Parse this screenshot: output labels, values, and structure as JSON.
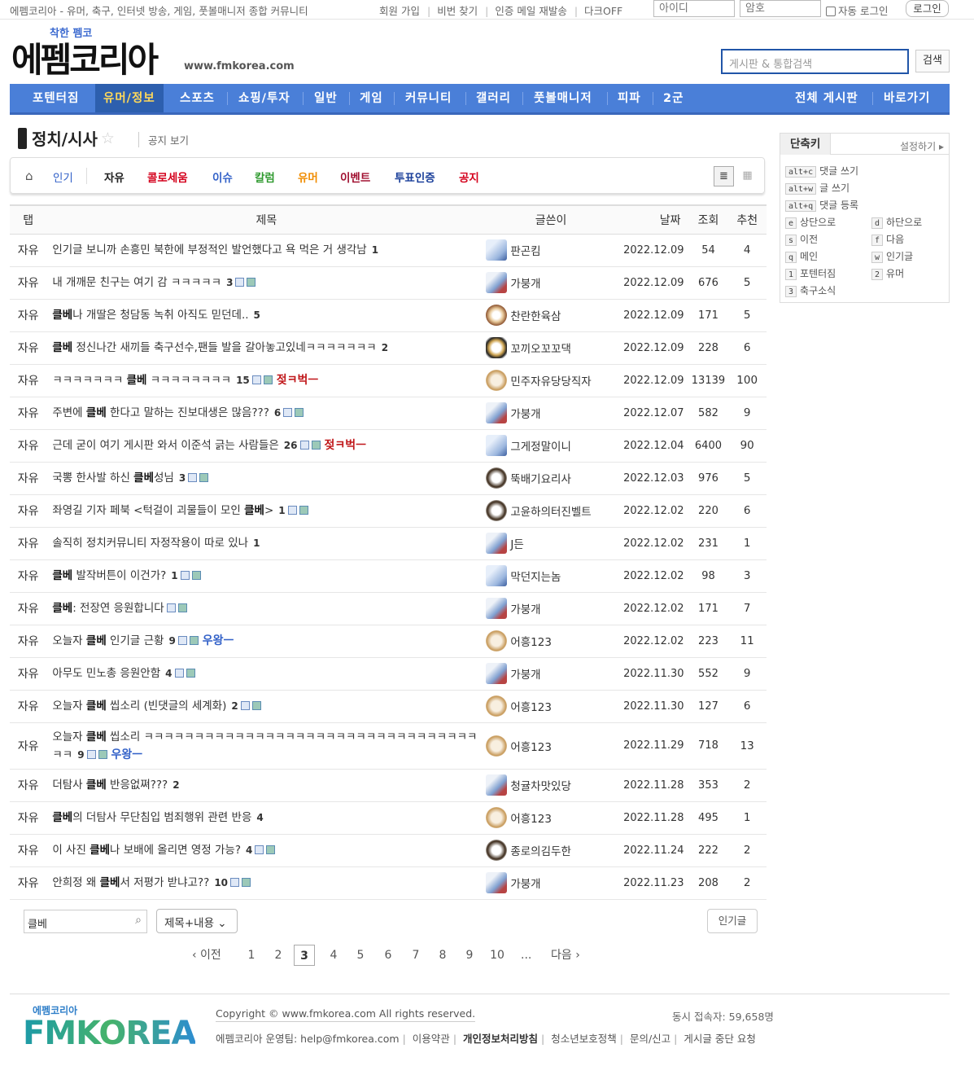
{
  "topbar": {
    "site_desc": "에펨코리아 - 유머, 축구, 인터넷 방송, 게임, 풋볼매니저 종합 커뮤니티",
    "links": [
      "회원 가입",
      "비번 찾기",
      "인증 메일 재발송",
      "다크OFF"
    ],
    "id_placeholder": "아이디",
    "pw_placeholder": "암호",
    "auto_login": "자동 로그인",
    "login": "로그인"
  },
  "header": {
    "slogan": "착한 펨코",
    "logo": "에펨코리아",
    "url": "www.fmkorea.com",
    "search_placeholder": "게시판 & 통합검색",
    "search_button": "검색"
  },
  "gnb": {
    "items": [
      "포텐터짐",
      "유머/정보",
      "스포츠",
      "쇼핑/투자",
      "일반",
      "게임",
      "커뮤니티",
      "갤러리",
      "풋볼매니저",
      "피파",
      "2군"
    ],
    "active": "유머/정보",
    "right": [
      "전체 게시판",
      "바로가기"
    ]
  },
  "board": {
    "title": "정치/시사",
    "notice_link": "공지 보기",
    "tabs": [
      {
        "label": "인기",
        "color": "#3261c8"
      },
      {
        "label": "자유",
        "color": "#222222"
      },
      {
        "label": "콜로세움",
        "color": "#d4001c"
      },
      {
        "label": "이슈",
        "color": "#3261c8"
      },
      {
        "label": "칼럼",
        "color": "#2f9a2f"
      },
      {
        "label": "유머",
        "color": "#f08c00"
      },
      {
        "label": "이벤트",
        "color": "#a01030"
      },
      {
        "label": "투표인증",
        "color": "#1a3f9a"
      },
      {
        "label": "공지",
        "color": "#d4001c"
      }
    ]
  },
  "table": {
    "headers": [
      "탭",
      "제목",
      "글쓴이",
      "날짜",
      "조회",
      "추천"
    ],
    "rows": [
      {
        "cat": "자유",
        "pre": "인기글 보니까 손흥민 북한에 부정적인 발언했다고 욕 먹은 거 생각남",
        "kw": "",
        "post": "",
        "comments": "1",
        "icons": 0,
        "badge": "",
        "author": "판곤킴",
        "av": "a1",
        "date": "2022.12.09",
        "views": "54",
        "rec": "4"
      },
      {
        "cat": "자유",
        "pre": "내 개깨문 친구는 여기 감 ㅋㅋㅋㅋㅋ",
        "kw": "",
        "post": "",
        "comments": "3",
        "icons": 2,
        "badge": "",
        "author": "가붕개",
        "av": "a2",
        "date": "2022.12.09",
        "views": "676",
        "rec": "5"
      },
      {
        "cat": "자유",
        "pre": "",
        "kw": "클베",
        "post": "나 개딸은 청담동 녹취 아직도 믿던데..",
        "comments": "5",
        "icons": 0,
        "badge": "",
        "author": "찬란한육삼",
        "av": "a3",
        "date": "2022.12.09",
        "views": "171",
        "rec": "5"
      },
      {
        "cat": "자유",
        "pre": "",
        "kw": "클베",
        "post": " 정신나간 새끼들 축구선수,팬들 발을 갈아놓고있네ㅋㅋㅋㅋㅋㅋㅋ",
        "comments": "2",
        "icons": 0,
        "badge": "",
        "author": "꼬끼오꼬꼬댁",
        "av": "a6",
        "date": "2022.12.09",
        "views": "228",
        "rec": "6"
      },
      {
        "cat": "자유",
        "pre": "ㅋㅋㅋㅋㅋㅋㅋ ",
        "kw": "클베",
        "post": " ㅋㅋㅋㅋㅋㅋㅋㅋ",
        "comments": "15",
        "icons": 2,
        "badge": "젖ㅋ벅ㅡ",
        "badge_color": "#c0181b",
        "author": "민주자유당당직자",
        "av": "a4",
        "date": "2022.12.09",
        "views": "13139",
        "rec": "100"
      },
      {
        "cat": "자유",
        "pre": "주변에 ",
        "kw": "클베",
        "post": " 한다고 말하는 진보대생은 많음???",
        "comments": "6",
        "icons": 2,
        "badge": "",
        "author": "가붕개",
        "av": "a2",
        "date": "2022.12.07",
        "views": "582",
        "rec": "9"
      },
      {
        "cat": "자유",
        "pre": "근데 굳이 여기 게시판 와서 이준석 긁는 사람들은",
        "kw": "",
        "post": "",
        "comments": "26",
        "icons": 2,
        "badge": "젖ㅋ벅ㅡ",
        "badge_color": "#c0181b",
        "author": "그게정말이니",
        "av": "a1",
        "date": "2022.12.04",
        "views": "6400",
        "rec": "90"
      },
      {
        "cat": "자유",
        "pre": "국뽕 한사발 하신 ",
        "kw": "클베",
        "post": "성님",
        "comments": "3",
        "icons": 2,
        "badge": "",
        "author": "뚝배기요리사",
        "av": "a5",
        "date": "2022.12.03",
        "views": "976",
        "rec": "5"
      },
      {
        "cat": "자유",
        "pre": "좌영길 기자 페북 <턱걸이 괴물들이 모인 ",
        "kw": "클베",
        "post": ">",
        "comments": "1",
        "icons": 2,
        "badge": "",
        "author": "고윤하의터진벨트",
        "av": "a5",
        "date": "2022.12.02",
        "views": "220",
        "rec": "6"
      },
      {
        "cat": "자유",
        "pre": "솔직히 정치커뮤니티 자정작용이 따로 있나",
        "kw": "",
        "post": "",
        "comments": "1",
        "icons": 0,
        "badge": "",
        "author": "J든",
        "av": "a2",
        "date": "2022.12.02",
        "views": "231",
        "rec": "1"
      },
      {
        "cat": "자유",
        "pre": "",
        "kw": "클베",
        "post": " 발작버튼이 이건가?",
        "comments": "1",
        "icons": 2,
        "badge": "",
        "author": "막던지는놈",
        "av": "a1",
        "date": "2022.12.02",
        "views": "98",
        "rec": "3"
      },
      {
        "cat": "자유",
        "pre": "",
        "kw": "클베",
        "post": ": 전장연 응원합니다",
        "comments": "",
        "icons": 2,
        "badge": "",
        "author": "가붕개",
        "av": "a2",
        "date": "2022.12.02",
        "views": "171",
        "rec": "7"
      },
      {
        "cat": "자유",
        "pre": "오늘자 ",
        "kw": "클베",
        "post": " 인기글 근황",
        "comments": "9",
        "icons": 2,
        "badge": "우왕ㅡ",
        "badge_color": "#3261c8",
        "author": "어흥123",
        "av": "a4",
        "date": "2022.12.02",
        "views": "223",
        "rec": "11"
      },
      {
        "cat": "자유",
        "pre": "아무도 민노총 응원안함",
        "kw": "",
        "post": "",
        "comments": "4",
        "icons": 2,
        "badge": "",
        "author": "가붕개",
        "av": "a2",
        "date": "2022.11.30",
        "views": "552",
        "rec": "9"
      },
      {
        "cat": "자유",
        "pre": "오늘자 ",
        "kw": "클베",
        "post": " 씹소리 (빈댓글의 세계화)",
        "comments": "2",
        "icons": 2,
        "badge": "",
        "author": "어흥123",
        "av": "a4",
        "date": "2022.11.30",
        "views": "127",
        "rec": "6"
      },
      {
        "cat": "자유",
        "pre": "오늘자 ",
        "kw": "클베",
        "post": " 씹소리 ㅋㅋㅋㅋㅋㅋㅋㅋㅋㅋㅋㅋㅋㅋㅋㅋㅋㅋㅋㅋㅋㅋㅋㅋㅋㅋㅋㅋㅋㅋㅋㅋㅋㅋㅋ",
        "comments": "9",
        "icons": 2,
        "badge": "우왕ㅡ",
        "badge_color": "#3261c8",
        "author": "어흥123",
        "av": "a4",
        "date": "2022.11.29",
        "views": "718",
        "rec": "13",
        "tall": true
      },
      {
        "cat": "자유",
        "pre": "더탐사 ",
        "kw": "클베",
        "post": " 반응없쪄???",
        "comments": "2",
        "icons": 0,
        "badge": "",
        "author": "청귤차맛있당",
        "av": "a2",
        "date": "2022.11.28",
        "views": "353",
        "rec": "2"
      },
      {
        "cat": "자유",
        "pre": "",
        "kw": "클베",
        "post": "의 더탐사 무단침입 범죄행위 관련 반응",
        "comments": "4",
        "icons": 0,
        "badge": "",
        "author": "어흥123",
        "av": "a4",
        "date": "2022.11.28",
        "views": "495",
        "rec": "1"
      },
      {
        "cat": "자유",
        "pre": "이 사진 ",
        "kw": "클베",
        "post": "나 보배에 올리면 영정 가능?",
        "comments": "4",
        "icons": 2,
        "badge": "",
        "author": "종로의김두한",
        "av": "a5",
        "date": "2022.11.24",
        "views": "222",
        "rec": "2"
      },
      {
        "cat": "자유",
        "pre": "안희정 왜 ",
        "kw": "클베",
        "post": "서 저평가 받냐고??",
        "comments": "10",
        "icons": 2,
        "badge": "",
        "author": "가붕개",
        "av": "a2",
        "date": "2022.11.23",
        "views": "208",
        "rec": "2"
      }
    ]
  },
  "shortcut": {
    "title": "단축키",
    "settings": "설정하기",
    "single": [
      {
        "key": "alt+c",
        "label": "댓글 쓰기"
      },
      {
        "key": "alt+w",
        "label": "글 쓰기"
      },
      {
        "key": "alt+q",
        "label": "댓글 등록"
      }
    ],
    "pairs": [
      [
        {
          "key": "e",
          "label": "상단으로"
        },
        {
          "key": "d",
          "label": "하단으로"
        }
      ],
      [
        {
          "key": "s",
          "label": "이전"
        },
        {
          "key": "f",
          "label": "다음"
        }
      ],
      [
        {
          "key": "q",
          "label": "메인"
        },
        {
          "key": "w",
          "label": "인기글"
        }
      ],
      [
        {
          "key": "1",
          "label": "포텐터짐"
        },
        {
          "key": "2",
          "label": "유머"
        }
      ],
      [
        {
          "key": "3",
          "label": "축구소식"
        }
      ]
    ]
  },
  "search_bottom": {
    "value": "클베",
    "scope": "제목+내용",
    "popular": "인기글"
  },
  "pagination": {
    "prev": "‹ 이전",
    "pages": [
      "1",
      "2",
      "3",
      "4",
      "5",
      "6",
      "7",
      "8",
      "9",
      "10"
    ],
    "current": "3",
    "ellipsis": "...",
    "next": "다음 ›"
  },
  "footer": {
    "logo_small": "에펨코리아",
    "logo": "FMKOREA",
    "copyright": "Copyright © www.fmkorea.com All rights reserved.",
    "concurrent": "동시 접속자: 59,658명",
    "links": [
      "에펨코리아 운영팀: help@fmkorea.com",
      "이용약관",
      "개인정보처리방침",
      "청소년보호정책",
      "문의/신고",
      "게시글 중단 요청"
    ]
  }
}
